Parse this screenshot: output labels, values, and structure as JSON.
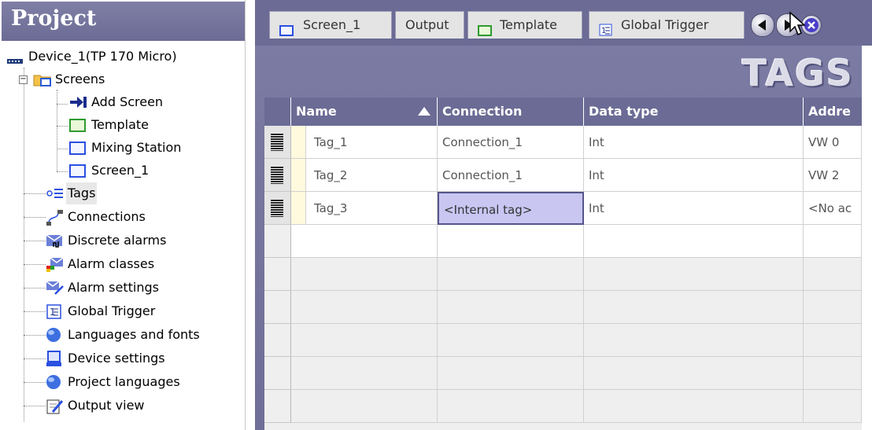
{
  "project": {
    "title": "Project",
    "tree": [
      {
        "label": "Device_1(TP 170 Micro)",
        "icon": "device-icon"
      },
      {
        "label": "Screens",
        "icon": "folder-icon"
      },
      {
        "label": "Add Screen",
        "icon": "add-screen-icon"
      },
      {
        "label": "Template",
        "icon": "template-icon"
      },
      {
        "label": "Mixing Station",
        "icon": "screen-icon"
      },
      {
        "label": "Screen_1",
        "icon": "screen-icon"
      },
      {
        "label": "Tags",
        "icon": "tags-icon"
      },
      {
        "label": "Connections",
        "icon": "connections-icon"
      },
      {
        "label": "Discrete alarms",
        "icon": "discrete-alarms-icon"
      },
      {
        "label": "Alarm classes",
        "icon": "alarm-classes-icon"
      },
      {
        "label": "Alarm settings",
        "icon": "alarm-settings-icon"
      },
      {
        "label": "Global Trigger",
        "icon": "global-trigger-icon"
      },
      {
        "label": "Languages and fonts",
        "icon": "globe-icon"
      },
      {
        "label": "Device settings",
        "icon": "device-settings-icon"
      },
      {
        "label": "Project languages",
        "icon": "globe-icon"
      },
      {
        "label": "Output view",
        "icon": "output-view-icon"
      }
    ]
  },
  "tabs": [
    {
      "label": "Screen_1",
      "icon": "screen-icon"
    },
    {
      "label": "Output",
      "icon": ""
    },
    {
      "label": "Template",
      "icon": "template-icon"
    },
    {
      "label": "Global Trigger",
      "icon": "global-trigger-icon"
    }
  ],
  "editor": {
    "heading": "TAGS",
    "columns": [
      "Name",
      "Connection",
      "Data type",
      "Addre"
    ],
    "rows": [
      {
        "name": "Tag_1",
        "connection": "Connection_1",
        "data_type": "Int",
        "address": "VW 0"
      },
      {
        "name": "Tag_2",
        "connection": "Connection_1",
        "data_type": "Int",
        "address": "VW 2"
      },
      {
        "name": "Tag_3",
        "connection": "<Internal tag>",
        "data_type": "Int",
        "address": "<No ac"
      }
    ]
  },
  "colors": {
    "header_bg": "#6b6b95",
    "selected_cell": "#c9c6f2",
    "grid_bg": "#efefef"
  }
}
